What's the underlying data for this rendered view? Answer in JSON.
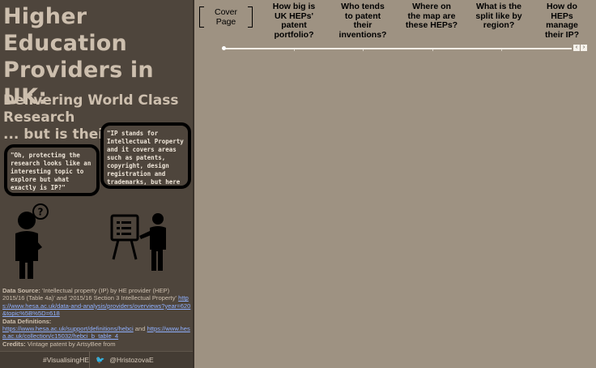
{
  "panel": {
    "title": "Higher Education Providers in UK:",
    "subtitle": "Delivering World Class Research",
    "subtitle_cont": "... but is their",
    "bubble_left": "\"Oh, protecting the research looks like an interesting topic to explore but what exactly is IP?\"",
    "bubble_right": "\"IP stands for Intellectual Property and it covers areas such as patents, copyright, design registration and trademarks, but here the author focuses on patents.\"",
    "data_source_label": "Data Source:",
    "data_source_text": "'Intellectual property (IP) by HE provider (HEP) 2015/16 (Table 4a)' and '2015/16 Section 3 Intellectual Property'",
    "data_source_link": "https://www.hesa.ac.uk/data-and-analysis/providers/overviews?year=620&topic%5B%5D=618",
    "definitions_label": "Data Definitions:",
    "definitions_link_1": "https://www.hesa.ac.uk/support/definitions/hebci",
    "definitions_and": "and",
    "definitions_link_2": "https://www.hesa.ac.uk/collection/c15032/hebci_b_table_4",
    "credits_label": "Credits:",
    "credits_text": "Vintage patent by ArtsyBee from",
    "footer_hashtag": "#VisualisingHE",
    "footer_handle": "@HristozovaE",
    "icons": {
      "question": "question-mark-icon",
      "twitter": "twitter-icon"
    }
  },
  "nav": {
    "cover": "Cover Page",
    "q1": "How big is UK HEPs' patent portfolio?",
    "q2": "Who tends to patent their inventions?",
    "q3": "Where on the map are these HEPs?",
    "q4": "What is the split like by region?",
    "q5": "How do HEPs manage their IP?",
    "prev_symbol": "‹",
    "next_symbol": "›",
    "progress": 0.0
  },
  "colors": {
    "panel_bg": "#4e453c",
    "canvas_bg": "#9e9282",
    "title": "#cdbfae",
    "link": "#8fb0ff"
  }
}
